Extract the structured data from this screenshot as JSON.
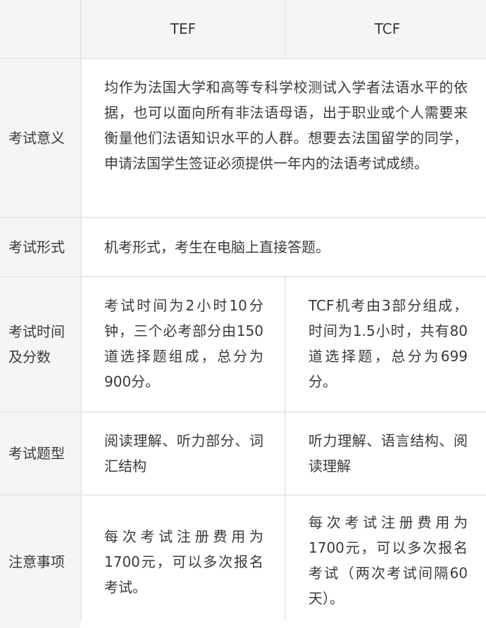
{
  "header": {
    "tef": "TEF",
    "tcf": "TCF"
  },
  "rows": [
    {
      "label": "考试意义",
      "shared": "均作为法国大学和高等专科学校测试入学者法语水平的依据，也可以面向所有非法语母语，出于职业或个人需要来衡量他们法语知识水平的人群。想要去法国留学的同学，申请法国学生签证必须提供一年内的法语考试成绩。"
    },
    {
      "label": "考试形式",
      "shared": "机考形式，考生在电脑上直接答题。"
    },
    {
      "label": "考试时间及分数",
      "tef": "考试时间为2小时10分钟，三个必考部分由150道选择题组成，总分为900分。",
      "tcf": "TCF机考由3部分组成，时间为1.5小时，共有80道选择题，总分为699分。"
    },
    {
      "label": "考试题型",
      "tef": "阅读理解、听力部分、词汇结构",
      "tcf": "听力理解、语言结构、阅读理解"
    },
    {
      "label": "注意事项",
      "tef": "每次考试注册费用为1700元，可以多次报名考试。",
      "tcf": "每次考试注册费用为1700元，可以多次报名考试（两次考试间隔60天）。"
    }
  ]
}
